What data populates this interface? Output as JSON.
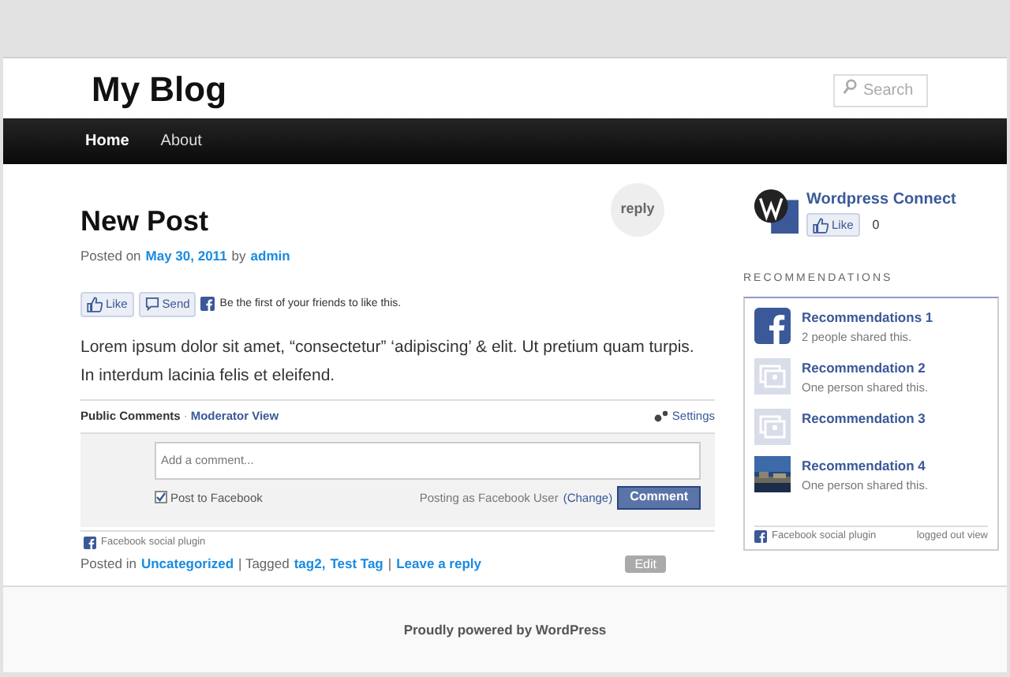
{
  "site_title": "My Blog",
  "search": {
    "placeholder": "Search"
  },
  "nav": [
    {
      "label": "Home",
      "selected": true
    },
    {
      "label": "About",
      "selected": false
    }
  ],
  "post": {
    "title": "New Post",
    "reply": "reply",
    "meta": {
      "prefix": "Posted on",
      "date": "May 30, 2011",
      "by": "by",
      "author": "admin"
    },
    "like": {
      "like": "Like",
      "send": "Send",
      "text": "Be the first of your friends to like this."
    },
    "body": [
      "Lorem ipsum dolor sit amet, “consectetur” ‘adipiscing’ & elit.  Ut pretium quam turpis.",
      "In interdum lacinia felis et eleifend."
    ],
    "comments": {
      "tabs": [
        {
          "label": "Public Comments",
          "selected": true
        },
        {
          "label": "Moderator View",
          "selected": false
        }
      ],
      "separator": "·",
      "settings": "Settings",
      "placeholder": "Add a comment...",
      "post_to_facebook": {
        "label": "Post to Facebook",
        "checked": true
      },
      "posting_as": "Posting as Facebook User",
      "change": "(Change)",
      "button": "Comment",
      "plugin": "Facebook social plugin"
    },
    "footer": {
      "posted_in": "Posted in",
      "category": "Uncategorized",
      "tagged": "| Tagged",
      "tags": [
        "tag2,",
        "Test Tag"
      ],
      "sep": "|",
      "leave_reply": "Leave a reply",
      "edit": "Edit"
    }
  },
  "connect": {
    "title": "Wordpress Connect",
    "like": "Like",
    "count": "0"
  },
  "recommendations": {
    "heading": "RECOMMENDATIONS",
    "items": [
      {
        "kind": "facebook",
        "title": "Recommendations 1",
        "subtitle": "2 people shared this."
      },
      {
        "kind": "placeholder",
        "title": "Recommendation 2",
        "subtitle": "One person shared this."
      },
      {
        "kind": "placeholder",
        "title": "Recommendation 3"
      },
      {
        "kind": "picture",
        "title": "Recommendation 4",
        "subtitle": "One person shared this."
      }
    ],
    "plugin": "Facebook social plugin",
    "logged_out": "logged out view"
  },
  "credit": "Proudly powered by WordPress"
}
